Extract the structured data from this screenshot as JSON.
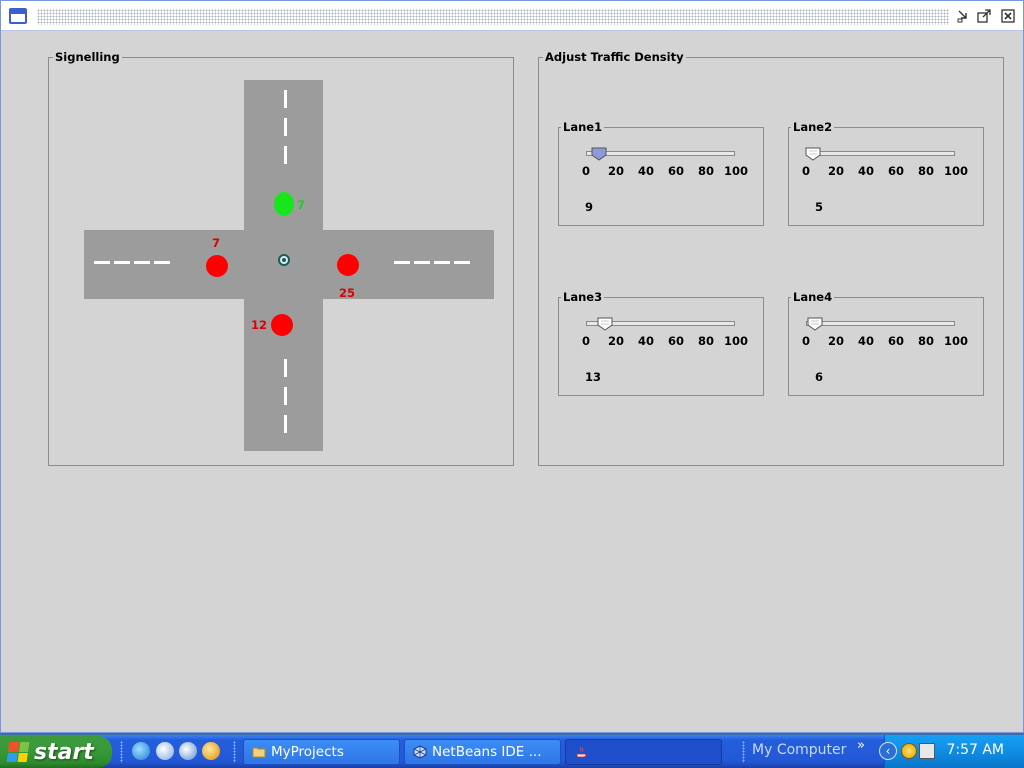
{
  "signalling": {
    "title": "Signelling",
    "north_count": "7",
    "west_count": "7",
    "east_count": "25",
    "south_count": "12"
  },
  "traffic": {
    "title": "Adjust Traffic Density",
    "ticks": [
      "0",
      "20",
      "40",
      "60",
      "80",
      "100"
    ],
    "lanes": [
      {
        "label": "Lane1",
        "value": "9"
      },
      {
        "label": "Lane2",
        "value": "5"
      },
      {
        "label": "Lane3",
        "value": "13"
      },
      {
        "label": "Lane4",
        "value": "6"
      }
    ]
  },
  "taskbar": {
    "start_label": "start",
    "tasks": [
      {
        "label": "MyProjects"
      },
      {
        "label": "NetBeans IDE ..."
      },
      {
        "label": ""
      }
    ],
    "my_computer_label": "My Computer",
    "chevron": "»",
    "clock": "7:57 AM"
  },
  "colors": {
    "road": "#9c9c9c",
    "signal_red": "#ff0000",
    "signal_green": "#19e51d",
    "taskbar_blue": "#245edb",
    "start_green": "#3a9a3a"
  }
}
